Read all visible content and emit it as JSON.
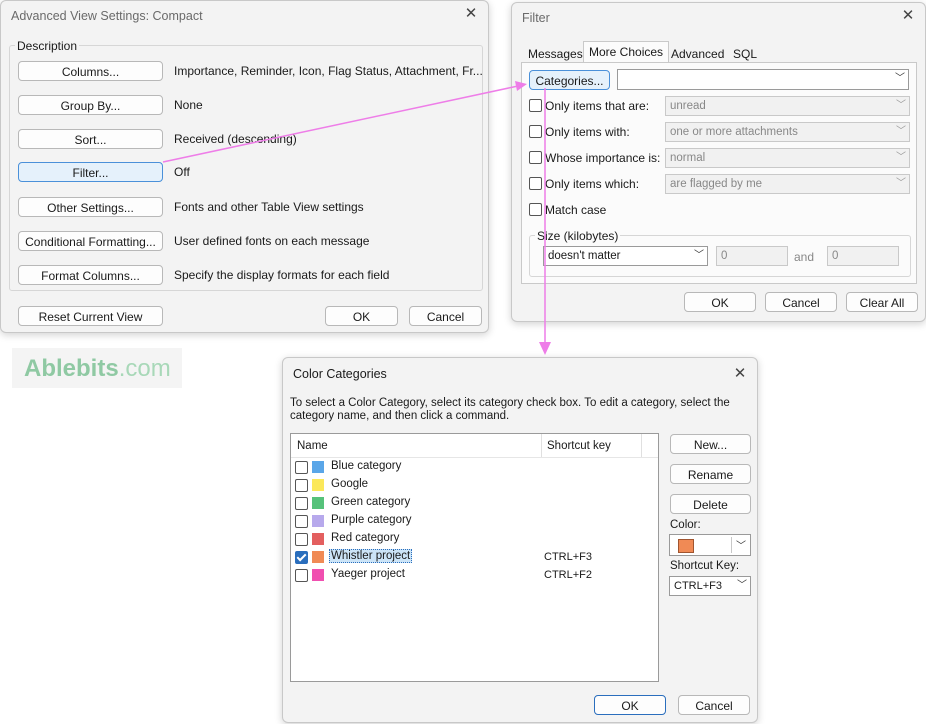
{
  "advanced": {
    "title": "Advanced View Settings: Compact",
    "description_label": "Description",
    "rows": [
      {
        "button": "Columns...",
        "value": "Importance, Reminder, Icon, Flag Status, Attachment, Fr..."
      },
      {
        "button": "Group By...",
        "value": "None"
      },
      {
        "button": "Sort...",
        "value": "Received (descending)"
      },
      {
        "button": "Filter...",
        "value": "Off"
      },
      {
        "button": "Other Settings...",
        "value": "Fonts and other Table View settings"
      },
      {
        "button": "Conditional Formatting...",
        "value": "User defined fonts on each message"
      },
      {
        "button": "Format Columns...",
        "value": "Specify the display formats for each field"
      }
    ],
    "reset_label": "Reset Current View",
    "ok_label": "OK",
    "cancel_label": "Cancel"
  },
  "watermark": {
    "brand": "Ablebits",
    "suffix": ".com"
  },
  "filter": {
    "title": "Filter",
    "tabs": [
      "Messages",
      "More Choices",
      "Advanced",
      "SQL"
    ],
    "active_tab": "More Choices",
    "categories_button": "Categories...",
    "categories_value": "",
    "options": [
      {
        "label": "Only items that are:",
        "value": "unread"
      },
      {
        "label": "Only items with:",
        "value": "one or more attachments"
      },
      {
        "label": "Whose importance is:",
        "value": "normal"
      },
      {
        "label": "Only items which:",
        "value": "are flagged by me"
      }
    ],
    "match_case": "Match case",
    "size_label": "Size (kilobytes)",
    "size_option": "doesn't matter",
    "size_min": "0",
    "size_and": "and",
    "size_max": "0",
    "ok_label": "OK",
    "cancel_label": "Cancel",
    "clear_label": "Clear All"
  },
  "color": {
    "title": "Color Categories",
    "instructions": "To select a Color Category, select its category check box.  To edit a category, select the category name, and then click a command.",
    "col_name": "Name",
    "col_shortcut": "Shortcut key",
    "categories": [
      {
        "name": "Blue category",
        "color": "#5aa6e8",
        "checked": false,
        "shortcut": ""
      },
      {
        "name": "Google",
        "color": "#fbe85a",
        "checked": false,
        "shortcut": ""
      },
      {
        "name": "Green category",
        "color": "#56c27a",
        "checked": false,
        "shortcut": ""
      },
      {
        "name": "Purple category",
        "color": "#b7a9ec",
        "checked": false,
        "shortcut": ""
      },
      {
        "name": "Red category",
        "color": "#e35f5f",
        "checked": false,
        "shortcut": ""
      },
      {
        "name": "Whistler project",
        "color": "#f08a55",
        "checked": true,
        "shortcut": "CTRL+F3"
      },
      {
        "name": "Yaeger project",
        "color": "#f04fb0",
        "checked": false,
        "shortcut": "CTRL+F2"
      }
    ],
    "new_label": "New...",
    "rename_label": "Rename",
    "delete_label": "Delete",
    "color_label": "Color:",
    "color_value": "#f08a55",
    "shortcut_label": "Shortcut Key:",
    "shortcut_value": "CTRL+F3",
    "ok_label": "OK",
    "cancel_label": "Cancel"
  },
  "accent": {
    "arrow": "#ee7de8",
    "selection": "#2a6ebd"
  }
}
